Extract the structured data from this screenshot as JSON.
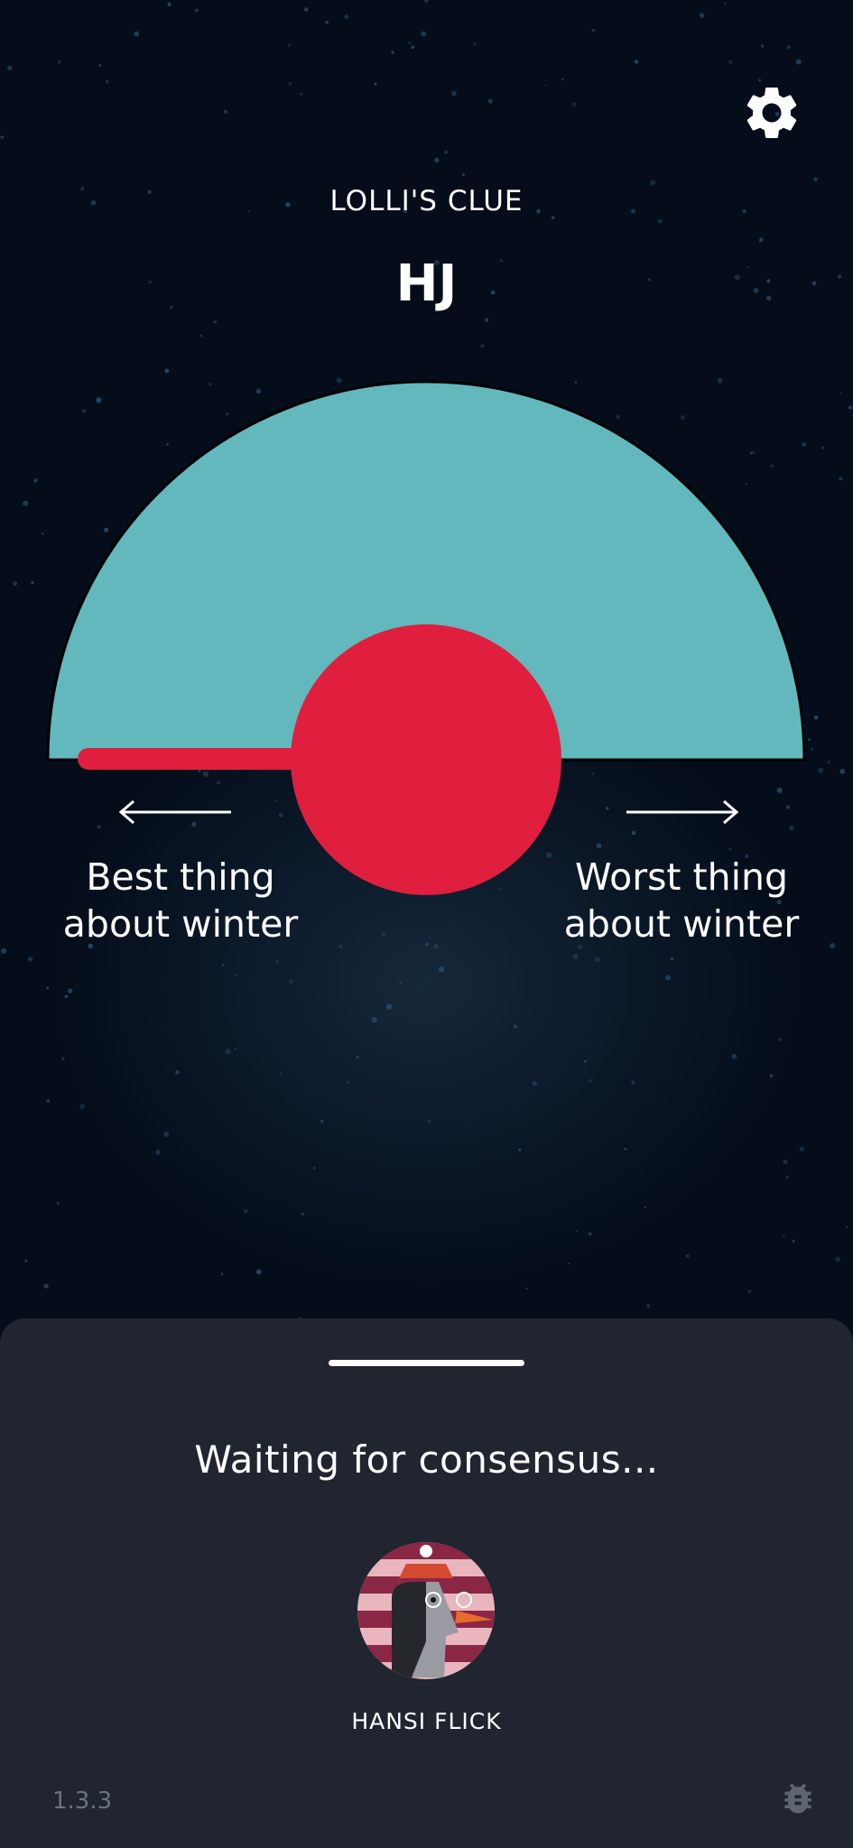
{
  "header": {
    "clue_title": "LOLLI'S CLUE",
    "clue_text": "HJ",
    "settings_icon": "gear-icon"
  },
  "dial": {
    "dial_color": "#62b8bd",
    "needle_color": "#df1f3d",
    "left_label_line1": "Best thing",
    "left_label_line2": "about winter",
    "right_label_line1": "Worst thing",
    "right_label_line2": "about winter"
  },
  "sheet": {
    "status": "Waiting for consensus...",
    "player_name": "HANSI FLICK",
    "version": "1.3.3",
    "bug_icon": "bug-icon"
  },
  "colors": {
    "background": "#050d1a",
    "sheet": "#202530",
    "text": "#ffffff"
  }
}
